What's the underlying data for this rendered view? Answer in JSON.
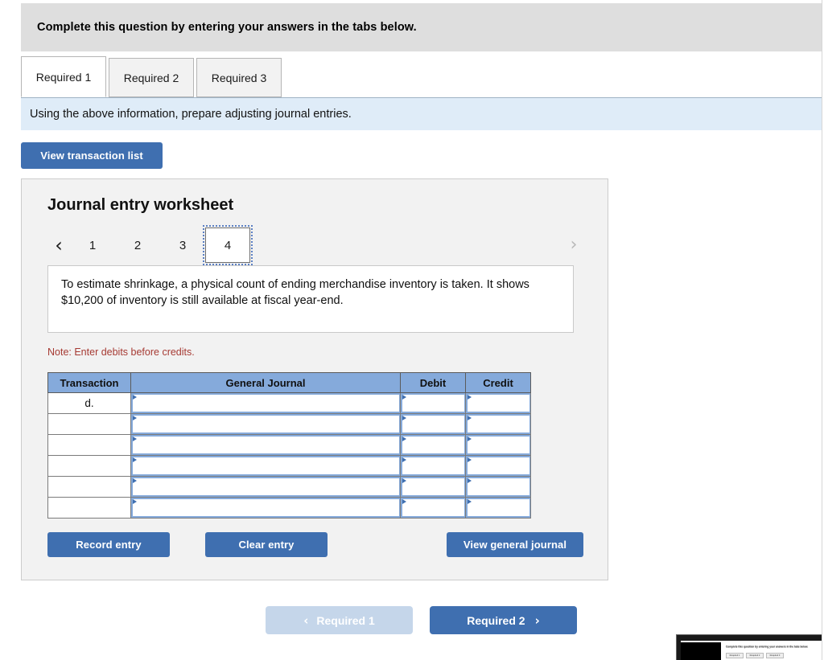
{
  "header": {
    "instruction": "Complete this question by entering your answers in the tabs below."
  },
  "tabs": [
    {
      "label": "Required 1",
      "active": true
    },
    {
      "label": "Required 2",
      "active": false
    },
    {
      "label": "Required 3",
      "active": false
    }
  ],
  "subheader": {
    "text": "Using the above information, prepare adjusting journal entries."
  },
  "toolbar": {
    "view_transaction_list": "View transaction list"
  },
  "worksheet": {
    "title": "Journal entry worksheet",
    "pager": {
      "prev_icon": "‹",
      "next_icon": "›",
      "pages": [
        "1",
        "2",
        "3",
        "4"
      ],
      "current": "4"
    },
    "question": "To estimate shrinkage, a physical count of ending merchandise inventory is taken. It shows $10,200 of inventory is still available at fiscal year-end.",
    "note": "Note: Enter debits before credits.",
    "table": {
      "columns": [
        "Transaction",
        "General Journal",
        "Debit",
        "Credit"
      ],
      "rows": [
        {
          "transaction": "d.",
          "general_journal": "",
          "debit": "",
          "credit": ""
        },
        {
          "transaction": "",
          "general_journal": "",
          "debit": "",
          "credit": ""
        },
        {
          "transaction": "",
          "general_journal": "",
          "debit": "",
          "credit": ""
        },
        {
          "transaction": "",
          "general_journal": "",
          "debit": "",
          "credit": ""
        },
        {
          "transaction": "",
          "general_journal": "",
          "debit": "",
          "credit": ""
        },
        {
          "transaction": "",
          "general_journal": "",
          "debit": "",
          "credit": ""
        }
      ]
    },
    "buttons": {
      "record_entry": "Record entry",
      "clear_entry": "Clear entry",
      "view_general_journal": "View general journal"
    }
  },
  "footer": {
    "prev_label": "Required 1",
    "prev_icon": "‹",
    "next_label": "Required 2",
    "next_icon": "›"
  },
  "pip": {
    "instruction": "Complete this question by entering your answers in the tabs below.",
    "tabs": [
      "Required 1",
      "Required 2",
      "Required 3"
    ]
  },
  "colors": {
    "accent_blue": "#3f6fb0",
    "header_blue": "#85aadb",
    "subbar_blue": "#dfecf8",
    "instruction_gray": "#dedede",
    "note_red": "#a63a33"
  }
}
